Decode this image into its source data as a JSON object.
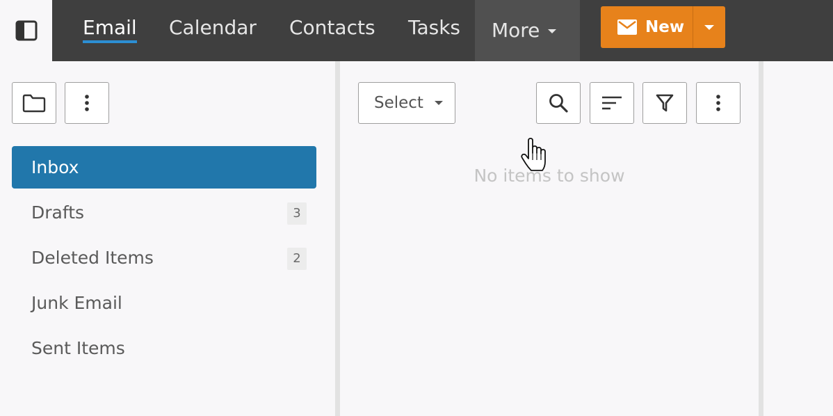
{
  "topbar": {
    "nav": [
      {
        "label": "Email",
        "active": true
      },
      {
        "label": "Calendar"
      },
      {
        "label": "Contacts"
      },
      {
        "label": "Tasks"
      },
      {
        "label": "More"
      }
    ],
    "new_label": "New",
    "colors": {
      "bar": "#3f3f3f",
      "new_button": "#e7821b",
      "active_underline": "#2c8fd4"
    }
  },
  "folders": [
    {
      "label": "Inbox",
      "active": true
    },
    {
      "label": "Drafts",
      "count": "3"
    },
    {
      "label": "Deleted Items",
      "count": "2"
    },
    {
      "label": "Junk Email"
    },
    {
      "label": "Sent Items"
    }
  ],
  "message_list": {
    "select_label": "Select",
    "empty_text": "No items to show"
  },
  "icons": [
    "sidebar-toggle-icon",
    "mail-icon",
    "folder-icon",
    "more-vertical-icon",
    "search-icon",
    "sort-icon",
    "filter-icon",
    "hand-cursor-icon"
  ],
  "accent": "#2177ab"
}
